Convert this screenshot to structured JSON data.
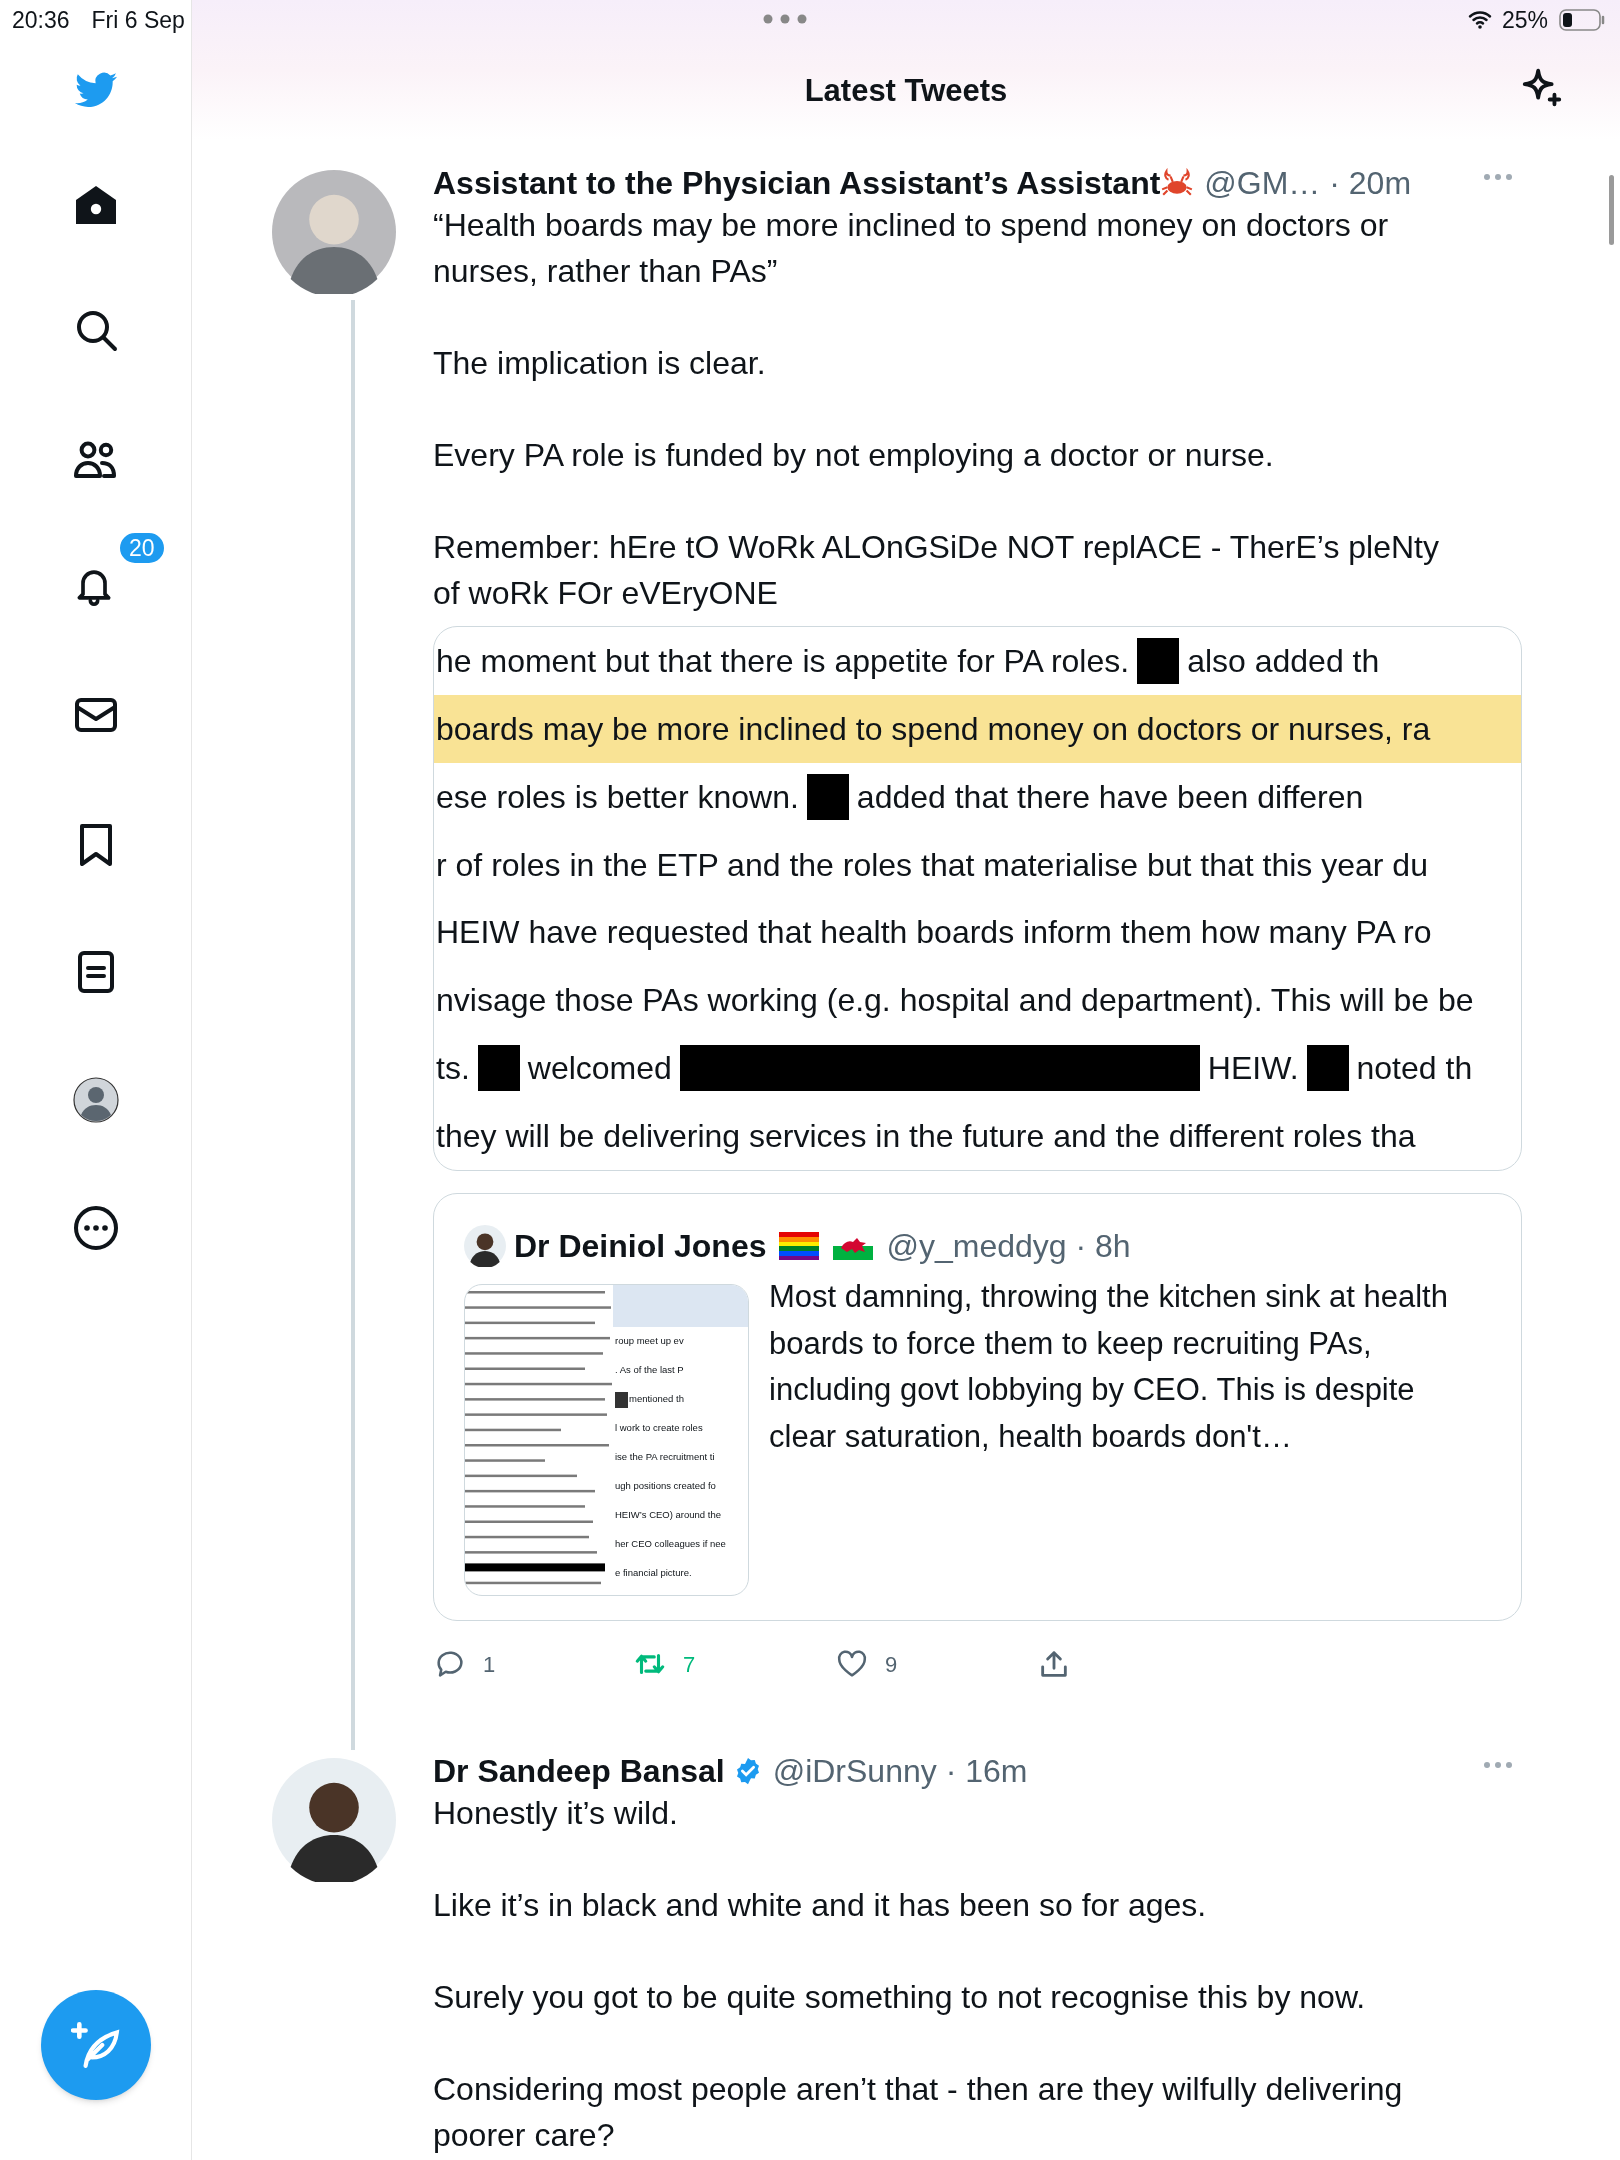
{
  "status_bar": {
    "time": "20:36",
    "date": "Fri 6 Sep",
    "battery": "25%"
  },
  "sidebar": {
    "notification_badge": "20"
  },
  "header": {
    "title": "Latest Tweets"
  },
  "tweets": [
    {
      "author": "Assistant to the Physician Assistant’s Assistant",
      "verified": false,
      "handle_time": "@GM… · 20m",
      "body": "“Health boards may be more inclined to spend money on doctors or nurses, rather than PAs”\n\nThe implication is clear.\n\nEvery PA role is funded by not employing a doctor or nurse.\n\nRemember: hEre tO WoRk ALOnGSiDe NOT replACE - TherE’s pleNty of woRk FOr eVEryONE",
      "image": {
        "lines": [
          {
            "highlighted": false,
            "segments": [
              {
                "kind": "text",
                "text": "he moment but that there is appetite for PA roles."
              },
              {
                "kind": "redaction"
              },
              {
                "kind": "text",
                "text": "also added th"
              }
            ]
          },
          {
            "highlighted": true,
            "segments": [
              {
                "kind": "text",
                "text": "boards may be more inclined to spend money on doctors or nurses, ra"
              }
            ]
          },
          {
            "highlighted": false,
            "segments": [
              {
                "kind": "text",
                "text": "ese roles is better known."
              },
              {
                "kind": "redaction"
              },
              {
                "kind": "text",
                "text": "added that there have been differen"
              }
            ]
          },
          {
            "highlighted": false,
            "segments": [
              {
                "kind": "text",
                "text": "r of roles in the ETP and the roles that materialise but that this year du"
              }
            ]
          },
          {
            "highlighted": false,
            "segments": [
              {
                "kind": "text",
                "text": "HEIW have requested that health boards inform them how many PA ro"
              }
            ]
          },
          {
            "highlighted": false,
            "segments": [
              {
                "kind": "text",
                "text": "nvisage those PAs working (e.g. hospital and department). This will be be"
              }
            ]
          },
          {
            "highlighted": false,
            "segments": [
              {
                "kind": "text",
                "text": "ts."
              },
              {
                "kind": "redaction"
              },
              {
                "kind": "text",
                "text": "welcomed"
              },
              {
                "kind": "long_redaction"
              },
              {
                "kind": "text",
                "text": "HEIW."
              },
              {
                "kind": "redaction"
              },
              {
                "kind": "text",
                "text": "noted th"
              }
            ]
          },
          {
            "highlighted": false,
            "segments": [
              {
                "kind": "text",
                "text": "they will be delivering services in the future and the different roles tha"
              }
            ]
          }
        ]
      },
      "quote": {
        "author": "Dr Deiniol Jones",
        "handle_time": "@y_meddyg · 8h",
        "text": "Most damning, throwing the kitchen sink at health boards to force them to keep recruiting PAs, including govt lobbying by CEO. This is despite clear saturation, health boards don't…",
        "thumbnail": {
          "right_lines": [
            {
              "segments": [
                {
                  "kind": "text",
                  "text": "roup meet up ev"
                }
              ]
            },
            {
              "segments": [
                {
                  "kind": "text",
                  "text": ". As of the last P"
                }
              ]
            },
            {
              "segments": [
                {
                  "kind": "redaction"
                },
                {
                  "kind": "text",
                  "text": "mentioned th"
                }
              ]
            },
            {
              "segments": [
                {
                  "kind": "text",
                  "text": "l work to create roles"
                }
              ]
            },
            {
              "segments": [
                {
                  "kind": "text",
                  "text": "ise the PA recruitment ti"
                }
              ]
            },
            {
              "segments": [
                {
                  "kind": "text",
                  "text": "ugh positions created fo"
                }
              ]
            },
            {
              "segments": [
                {
                  "kind": "text",
                  "text": "HEIW’s CEO) around the"
                }
              ]
            },
            {
              "segments": [
                {
                  "kind": "text",
                  "text": "her CEO colleagues if nee"
                }
              ]
            },
            {
              "segments": [
                {
                  "kind": "text",
                  "text": "e financial picture."
                }
              ]
            }
          ]
        }
      },
      "actions": {
        "replies": "1",
        "retweets": "7",
        "retweeted": true,
        "likes": "9",
        "liked": false
      }
    },
    {
      "author": "Dr Sandeep Bansal",
      "verified": true,
      "handle_time": "@iDrSunny · 16m",
      "body": "Honestly it’s wild.\n\nLike it’s in black and white and it has been so for ages.\n\nSurely you got to be quite something to not recognise this by now.\n\nConsidering most people aren’t that - then are they wilfully delivering poorer care?"
    }
  ]
}
